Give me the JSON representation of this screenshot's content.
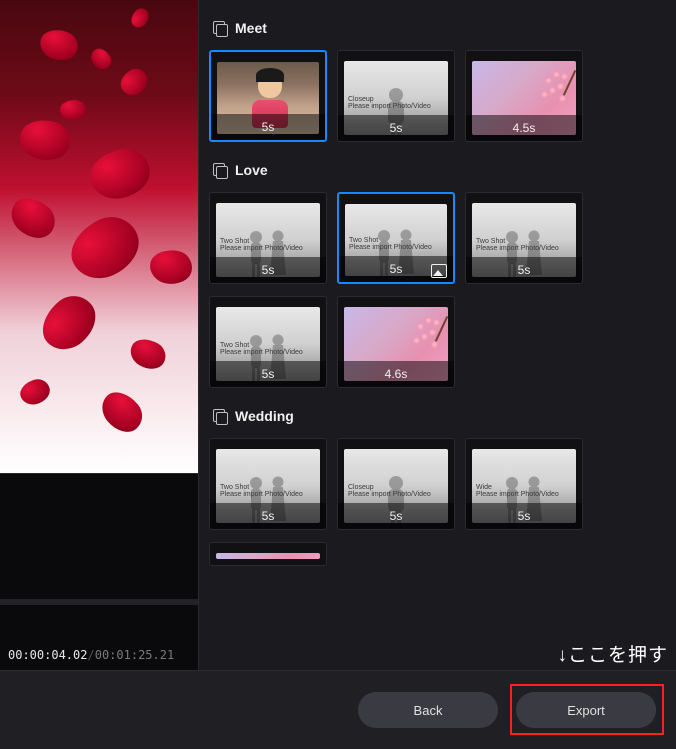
{
  "timecode": {
    "current": "00:00:04.02",
    "total": "00:01:25.21"
  },
  "sections": [
    {
      "title": "Meet",
      "clips": [
        {
          "duration": "5s",
          "kind": "photo",
          "selected": true,
          "meta1": "",
          "meta2": ""
        },
        {
          "duration": "5s",
          "kind": "closeup",
          "selected": false,
          "meta1": "Closeup",
          "meta2": "Please import Photo/Video"
        },
        {
          "duration": "4.5s",
          "kind": "sakura",
          "selected": false,
          "meta1": "",
          "meta2": ""
        }
      ]
    },
    {
      "title": "Love",
      "clips": [
        {
          "duration": "5s",
          "kind": "twoshot",
          "selected": false,
          "meta1": "Two Shot",
          "meta2": "Please import Photo/Video"
        },
        {
          "duration": "5s",
          "kind": "twoshot",
          "selected": true,
          "meta1": "Two Shot",
          "meta2": "Please import Photo/Video",
          "hasImageIcon": true
        },
        {
          "duration": "5s",
          "kind": "twoshot",
          "selected": false,
          "meta1": "Two Shot",
          "meta2": "Please import Photo/Video"
        },
        {
          "duration": "5s",
          "kind": "twoshot",
          "selected": false,
          "meta1": "Two Shot",
          "meta2": "Please import Photo/Video"
        },
        {
          "duration": "4.6s",
          "kind": "sakura",
          "selected": false,
          "meta1": "",
          "meta2": ""
        }
      ]
    },
    {
      "title": "Wedding",
      "clips": [
        {
          "duration": "5s",
          "kind": "twoshot",
          "selected": false,
          "meta1": "Two Shot",
          "meta2": "Please import Photo/Video"
        },
        {
          "duration": "5s",
          "kind": "closeup",
          "selected": false,
          "meta1": "Closeup",
          "meta2": "Please import Photo/Video"
        },
        {
          "duration": "5s",
          "kind": "wide",
          "selected": false,
          "meta1": "Wide",
          "meta2": "Please import Photo/Video"
        },
        {
          "duration": "",
          "kind": "sakura-partial",
          "selected": false,
          "meta1": "",
          "meta2": ""
        }
      ]
    }
  ],
  "buttons": {
    "back": "Back",
    "export": "Export"
  },
  "annotation": "↓ここを押す"
}
